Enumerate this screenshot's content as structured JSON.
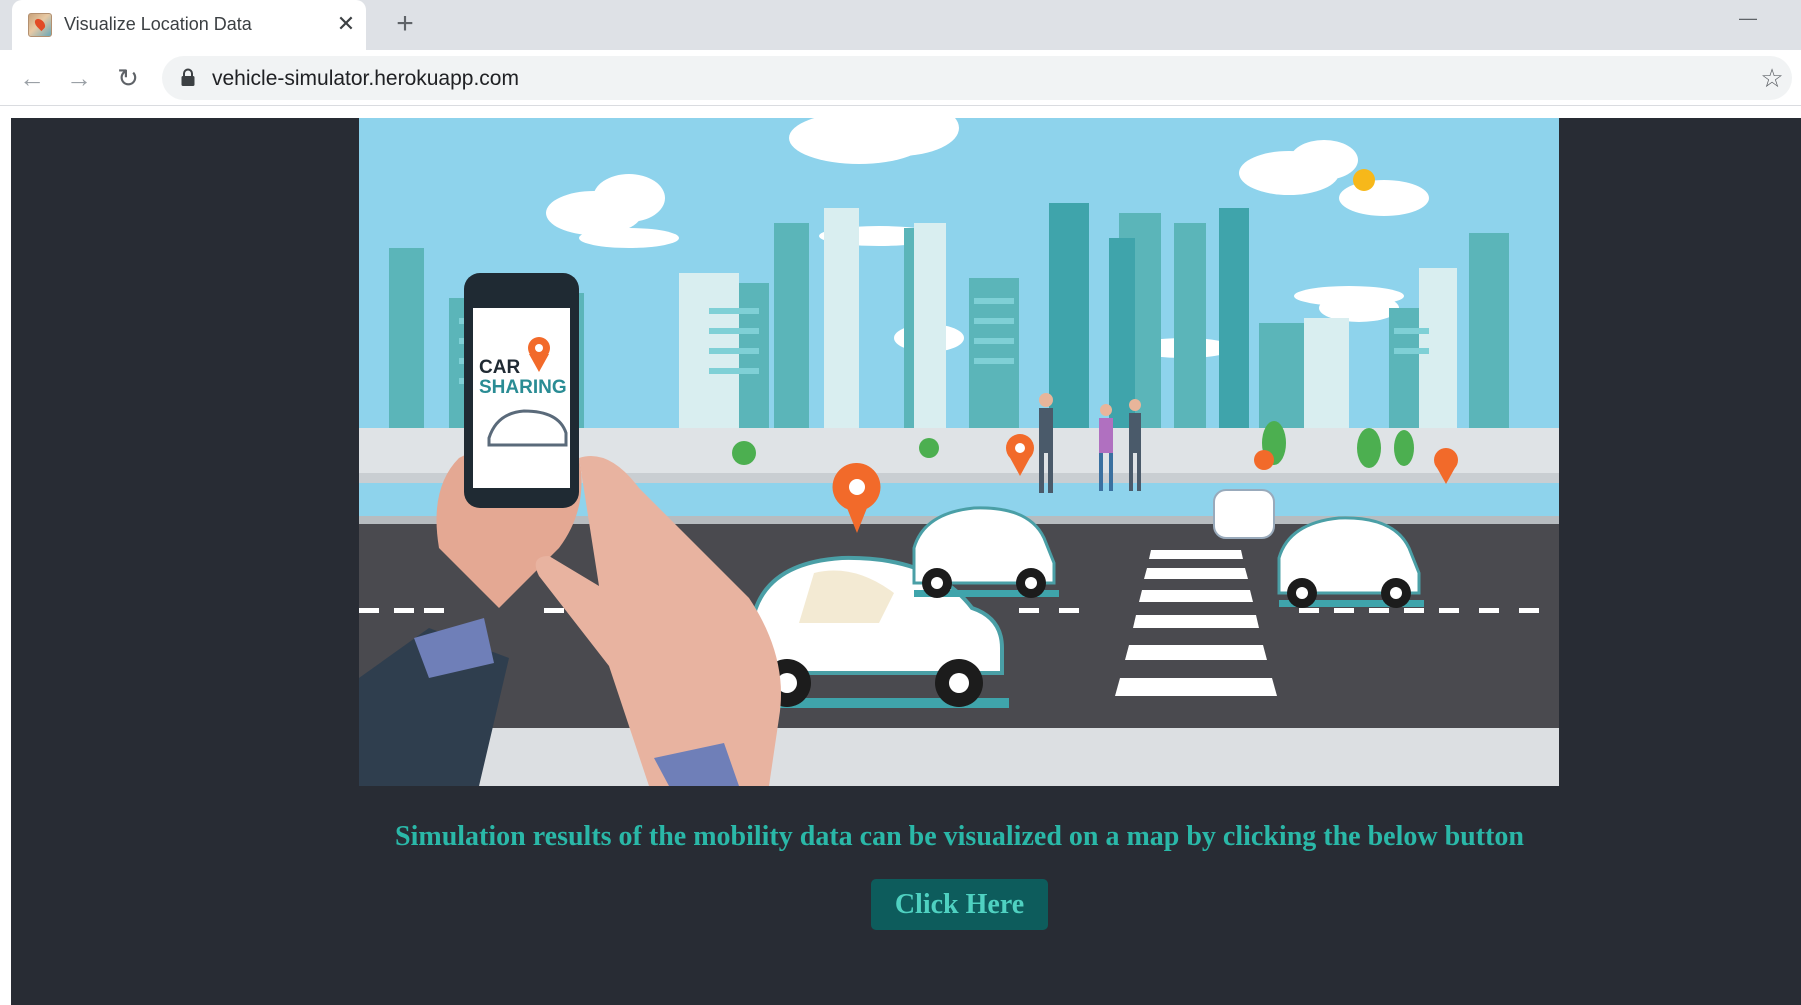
{
  "browser": {
    "tab_title": "Visualize Location Data",
    "tab_close_glyph": "✕",
    "new_tab_glyph": "+",
    "minimize_glyph": "—",
    "back_glyph": "←",
    "forward_glyph": "→",
    "reload_glyph": "↻",
    "url": "vehicle-simulator.herokuapp.com",
    "bookmark_glyph": "☆"
  },
  "hero": {
    "phone_text_line1": "CAR",
    "phone_text_line2": "SHARING"
  },
  "main": {
    "tagline": "Simulation results of the mobility data can be visualized on a map by clicking the below button",
    "cta_label": "Click Here"
  },
  "colors": {
    "page_background": "#282c34",
    "tagline": "#2ab8a8",
    "button_background": "#0d5c5c",
    "button_text": "#4fd1c1"
  }
}
